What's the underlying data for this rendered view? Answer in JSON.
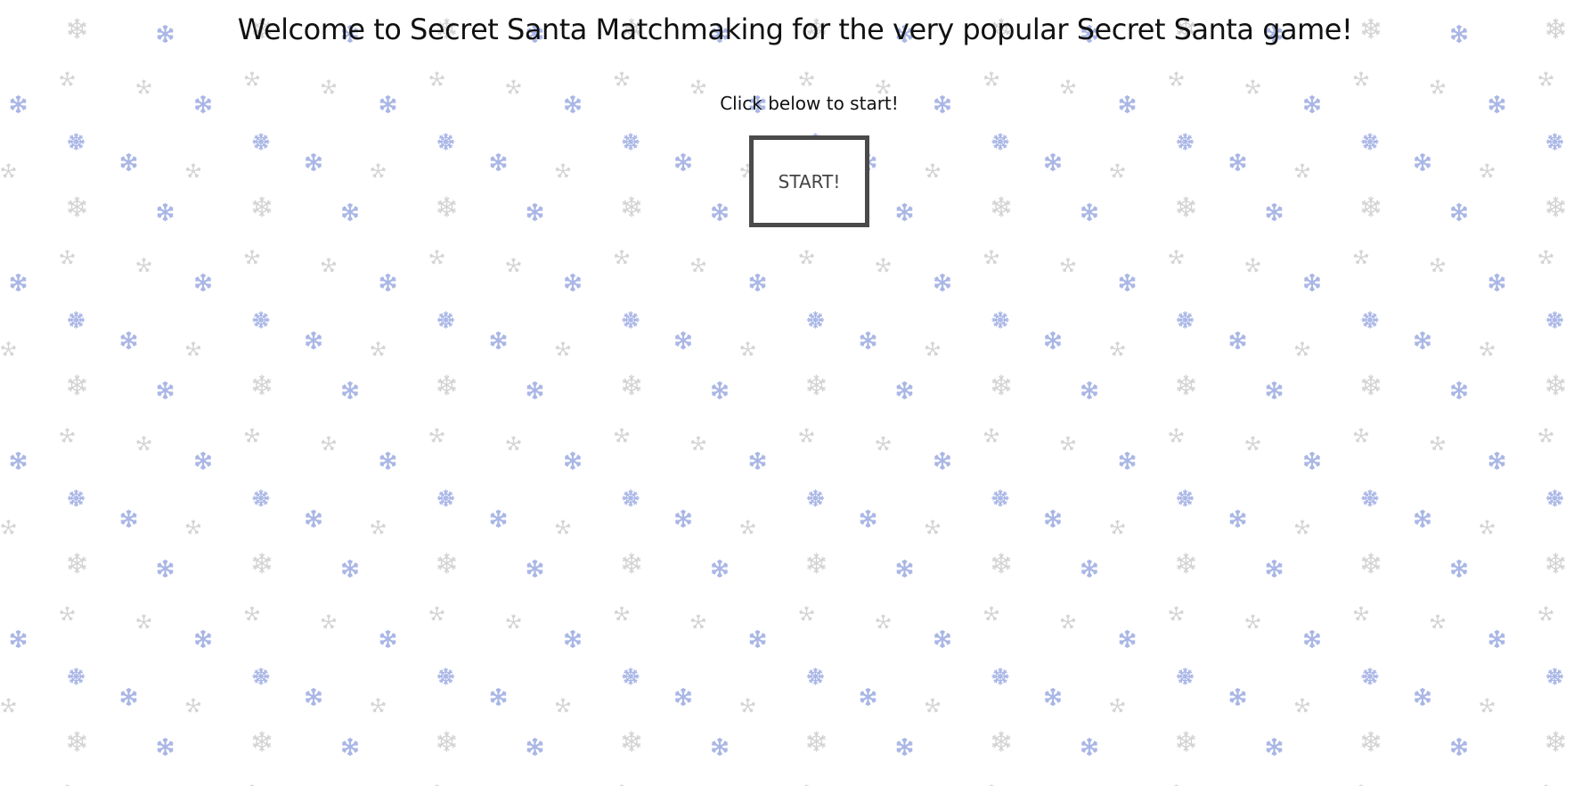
{
  "page": {
    "title": "Welcome to Secret Santa Matchmaking for the very popular Secret Santa game!",
    "subtitle": "Click below to start!",
    "start_button_label": "START!"
  },
  "background": {
    "pattern": "snowflake-icon",
    "colors": {
      "blue": "#a9b6e6",
      "gray": "#d2d2d2"
    }
  }
}
